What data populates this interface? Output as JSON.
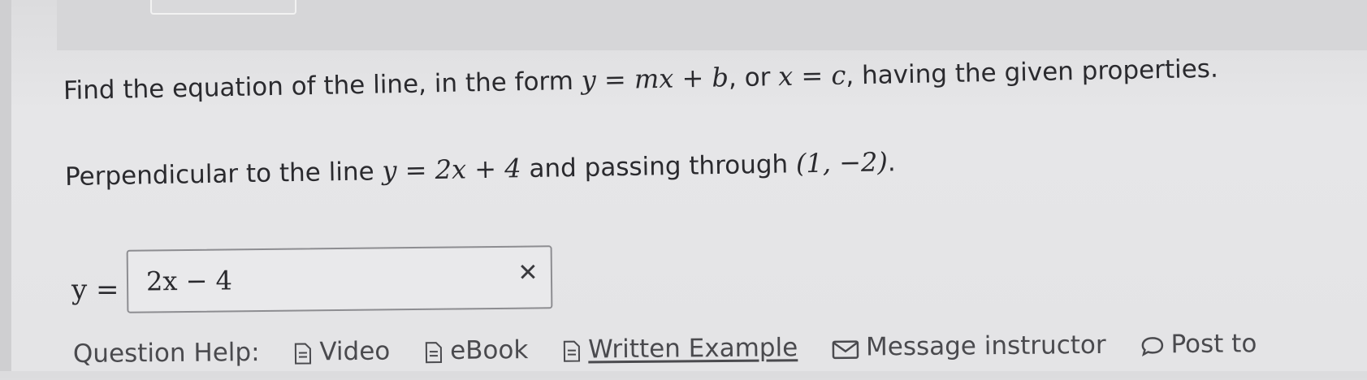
{
  "question": {
    "prompt_prefix": "Find the equation of the line, in the form ",
    "form_one": "y = mx + b",
    "prompt_or": ", or ",
    "form_two": "x = c",
    "prompt_suffix": ", having the given properties.",
    "condition_prefix": "Perpendicular to the line ",
    "given_line": "y = 2x + 4",
    "condition_middle": " and passing through ",
    "point": "(1, −2)",
    "condition_suffix": "."
  },
  "answer": {
    "label": "y =",
    "value": "2x − 4",
    "status_icon": "x-mark-icon",
    "status_color": "#3a3a3e"
  },
  "help": {
    "label": "Question Help:",
    "items": [
      {
        "label": "Video",
        "icon": "document-icon"
      },
      {
        "label": "eBook",
        "icon": "document-icon"
      },
      {
        "label": "Written Example",
        "icon": "document-icon"
      },
      {
        "label": "Message instructor",
        "icon": "envelope-icon"
      },
      {
        "label": "Post to",
        "icon": "speech-bubble-icon"
      }
    ]
  }
}
